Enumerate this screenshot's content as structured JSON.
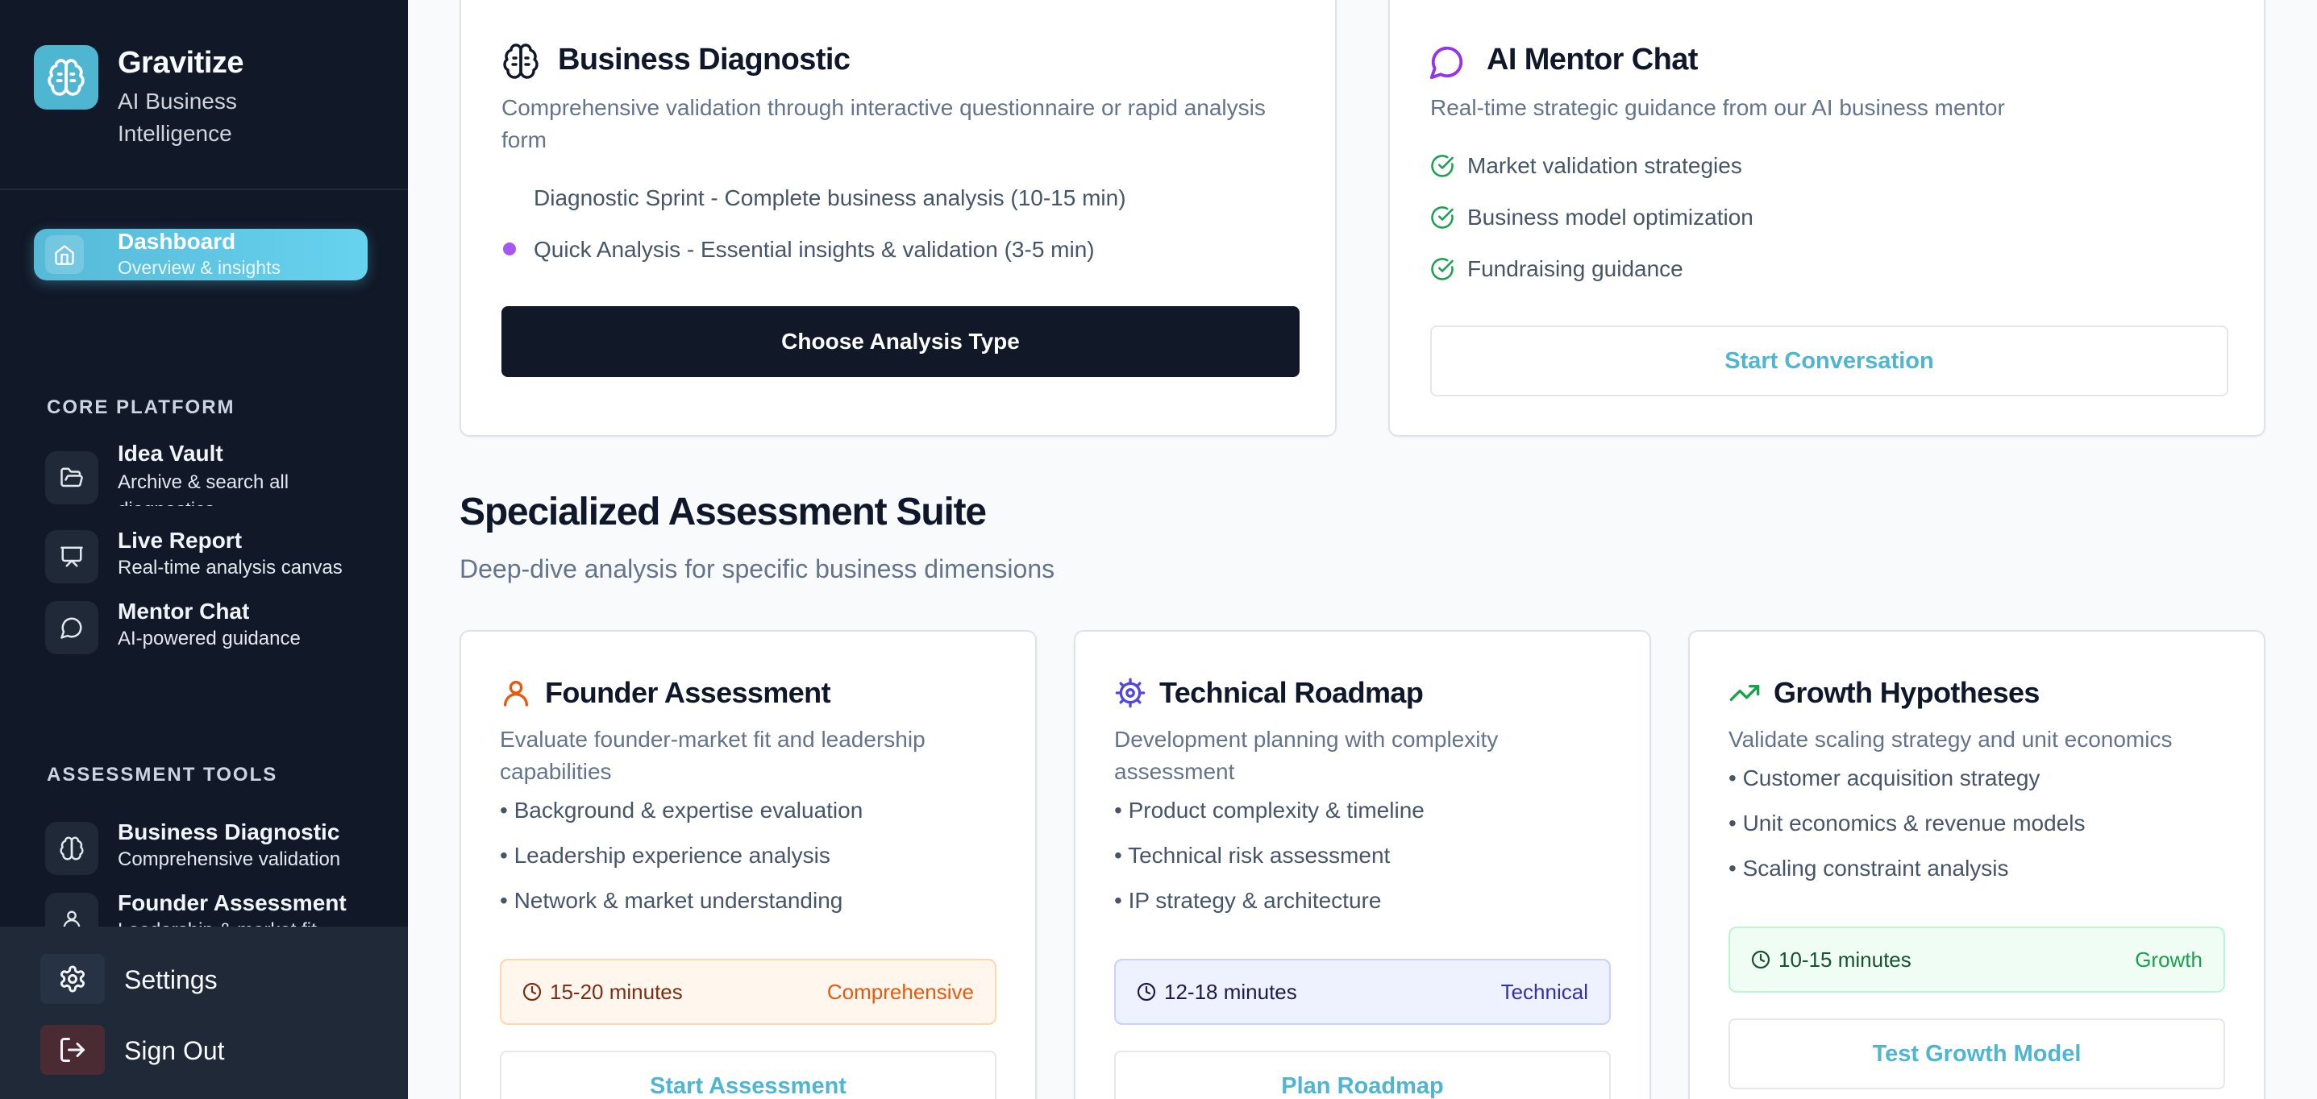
{
  "brand": {
    "name": "Gravitize",
    "subtitle": "AI Business Intelligence"
  },
  "nav": {
    "dashboard": {
      "title": "Dashboard",
      "sub": "Overview & insights"
    },
    "core_platform_label": "CORE PLATFORM",
    "core": [
      {
        "title": "Idea Vault",
        "sub": "Archive & search all diagnostics"
      },
      {
        "title": "Live Report",
        "sub": "Real-time analysis canvas"
      },
      {
        "title": "Mentor Chat",
        "sub": "AI-powered guidance"
      }
    ],
    "assessment_label": "ASSESSMENT TOOLS",
    "assessment": [
      {
        "title": "Business Diagnostic",
        "sub": "Comprehensive validation"
      },
      {
        "title": "Founder Assessment",
        "sub": "Leadership & market fit"
      }
    ],
    "settings": "Settings",
    "signout": "Sign Out"
  },
  "diagnostic": {
    "title": "Business Diagnostic",
    "desc": "Comprehensive validation through interactive questionnaire or rapid analysis form",
    "options": [
      "Diagnostic Sprint - Complete business analysis (10-15 min)",
      "Quick Analysis - Essential insights & validation (3-5 min)"
    ],
    "button": "Choose Analysis Type"
  },
  "mentor": {
    "title": "AI Mentor Chat",
    "desc": "Real-time strategic guidance from our AI business mentor",
    "features": [
      "Market validation strategies",
      "Business model optimization",
      "Fundraising guidance"
    ],
    "button": "Start Conversation"
  },
  "suite": {
    "title": "Specialized Assessment Suite",
    "subtitle": "Deep-dive analysis for specific business dimensions"
  },
  "founder": {
    "title": "Founder Assessment",
    "desc": "Evaluate founder-market fit and leadership capabilities",
    "features": [
      "• Background & expertise evaluation",
      "• Leadership experience analysis",
      "• Network & market understanding"
    ],
    "time": "15-20 minutes",
    "tag": "Comprehensive",
    "button": "Start Assessment"
  },
  "roadmap": {
    "title": "Technical Roadmap",
    "desc": "Development planning with complexity assessment",
    "features": [
      "• Product complexity & timeline",
      "• Technical risk assessment",
      "• IP strategy & architecture"
    ],
    "time": "12-18 minutes",
    "tag": "Technical",
    "button": "Plan Roadmap"
  },
  "growth": {
    "title": "Growth Hypotheses",
    "desc": "Validate scaling strategy and unit economics",
    "features": [
      "• Customer acquisition strategy",
      "• Unit economics & revenue models",
      "• Scaling constraint analysis"
    ],
    "time": "10-15 minutes",
    "tag": "Growth",
    "button": "Test Growth Model"
  },
  "colors": {
    "sidebar_bg": "#111827",
    "accent": "#4fb6d1",
    "founder_accent": "#ea580c",
    "technical_accent": "#4f46e5",
    "growth_accent": "#16a34a",
    "mentor_accent": "#9333ea"
  },
  "icons": {
    "brand": "brain-icon",
    "dashboard": "home-icon",
    "idea_vault": "folder-open-icon",
    "live_report": "presentation-icon",
    "mentor_chat": "message-circle-icon",
    "business_diagnostic": "brain-icon",
    "founder_assessment": "user-icon",
    "settings": "gear-icon",
    "signout": "log-out-icon",
    "technical": "cog-icon",
    "growth": "trending-up-icon",
    "check": "check-circle-icon",
    "clock": "clock-icon"
  }
}
